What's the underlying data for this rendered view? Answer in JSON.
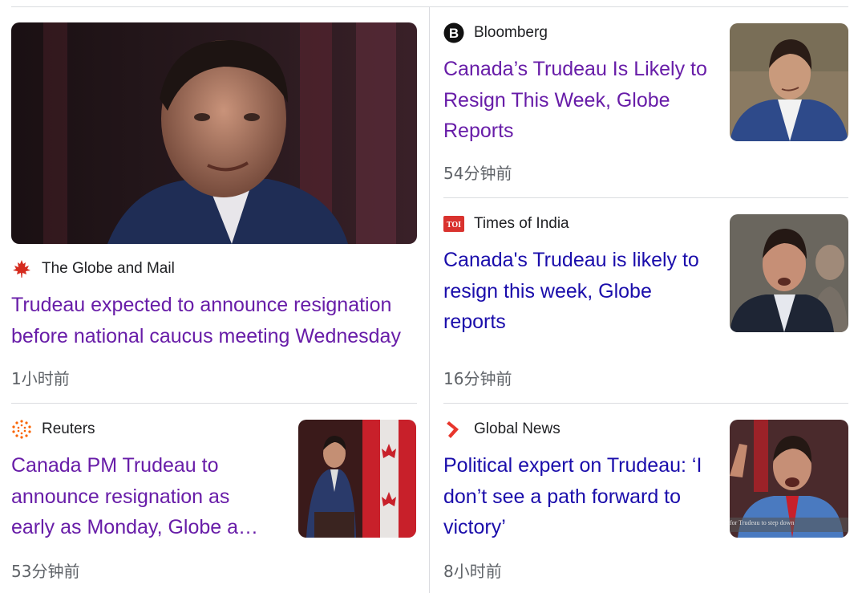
{
  "articles": [
    {
      "source": "The Globe and Mail",
      "source_icon": "maple-leaf-icon",
      "title": "Trudeau expected to announce resignation before national caucus meeting Wednesday",
      "time": "1小时前"
    },
    {
      "source": "Bloomberg",
      "source_icon": "bloomberg-b-icon",
      "title": "Canada’s Trudeau Is Likely to Resign This Week, Globe Reports",
      "time": "54分钟前"
    },
    {
      "source": "Times of India",
      "source_icon": "toi-icon",
      "source_icon_text": "TOI",
      "title": "Canada's Trudeau is likely to resign this week, Globe reports",
      "time": "16分钟前"
    },
    {
      "source": "Reuters",
      "source_icon": "reuters-dots-icon",
      "title": "Canada PM Trudeau to announce resignation as early as Monday, Globe a…",
      "time": "53分钟前"
    },
    {
      "source": "Global News",
      "source_icon": "global-news-chevron-icon",
      "title": "Political expert on Trudeau: ‘I don’t see a path forward to victory’",
      "time": "8小时前",
      "thumb_caption": "for Trudeau to step down"
    }
  ],
  "colors": {
    "visited_link": "#681da8",
    "link": "#1a0dab",
    "meta_text": "#5f6368",
    "divider": "#dadce0"
  }
}
